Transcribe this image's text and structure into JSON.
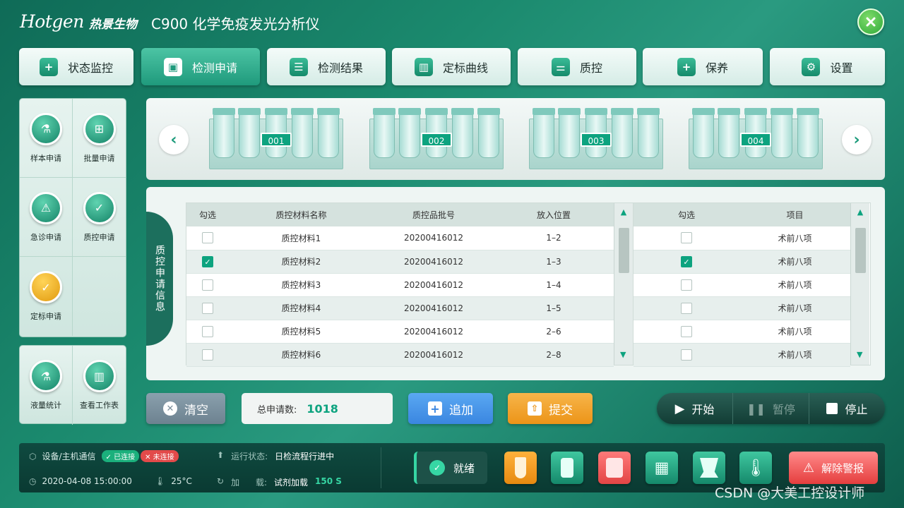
{
  "header": {
    "logo": "Hotgen",
    "brand_cn": "热景生物",
    "model": "C900  化学免疫发光分析仪"
  },
  "tabs": [
    {
      "label": "状态监控",
      "icon": "shield-plus-icon"
    },
    {
      "label": "检测申请",
      "icon": "user-card-icon",
      "active": true
    },
    {
      "label": "检测结果",
      "icon": "clipboard-icon"
    },
    {
      "label": "定标曲线",
      "icon": "chart-icon"
    },
    {
      "label": "质控",
      "icon": "sliders-icon"
    },
    {
      "label": "保养",
      "icon": "medkit-icon"
    },
    {
      "label": "设置",
      "icon": "gear-icon"
    }
  ],
  "left_menu": {
    "top": [
      "样本申请",
      "批量申请",
      "急诊申请",
      "质控申请",
      "定标申请"
    ],
    "bottom": [
      "液量统计",
      "查看工作表"
    ]
  },
  "racks": [
    "001",
    "002",
    "003",
    "004"
  ],
  "info_panel_title": "质控申请信息",
  "qc_table": {
    "headers": [
      "勾选",
      "质控材料名称",
      "质控品批号",
      "放入位置"
    ],
    "rows": [
      {
        "checked": false,
        "name": "质控材料1",
        "lot": "20200416012",
        "pos": "1–2"
      },
      {
        "checked": true,
        "name": "质控材料2",
        "lot": "20200416012",
        "pos": "1–3"
      },
      {
        "checked": false,
        "name": "质控材料3",
        "lot": "20200416012",
        "pos": "1–4"
      },
      {
        "checked": false,
        "name": "质控材料4",
        "lot": "20200416012",
        "pos": "1–5"
      },
      {
        "checked": false,
        "name": "质控材料5",
        "lot": "20200416012",
        "pos": "2–6"
      },
      {
        "checked": false,
        "name": "质控材料6",
        "lot": "20200416012",
        "pos": "2–8"
      }
    ]
  },
  "item_table": {
    "headers": [
      "勾选",
      "项目"
    ],
    "rows": [
      {
        "checked": false,
        "item": "术前八项"
      },
      {
        "checked": true,
        "item": "术前八项"
      },
      {
        "checked": false,
        "item": "术前八项"
      },
      {
        "checked": false,
        "item": "术前八项"
      },
      {
        "checked": false,
        "item": "术前八项"
      },
      {
        "checked": false,
        "item": "术前八项"
      }
    ]
  },
  "actions": {
    "clear": "清空",
    "total_label": "总申请数:",
    "total_value": "1018",
    "add": "追加",
    "submit": "提交"
  },
  "controls": {
    "start": "开始",
    "pause": "暂停",
    "stop": "停止"
  },
  "status": {
    "comm_label": "设备/主机通信",
    "connected": "已连接",
    "disconnected": "未连接",
    "run_label": "运行状态:",
    "run_value": "日检流程行进中",
    "datetime": "2020-04-08  15:00:00",
    "temperature": "25°C",
    "load_label": "加      载:",
    "load_value": "试剂加载",
    "load_time": "150 S",
    "ready": "就绪",
    "alarm": "解除警报"
  },
  "watermark": "CSDN @大美工控设计师",
  "colors": {
    "accent": "#0da37f",
    "orange": "#f0a020",
    "blue": "#3a8ee6",
    "alarm": "#e53e3e"
  }
}
